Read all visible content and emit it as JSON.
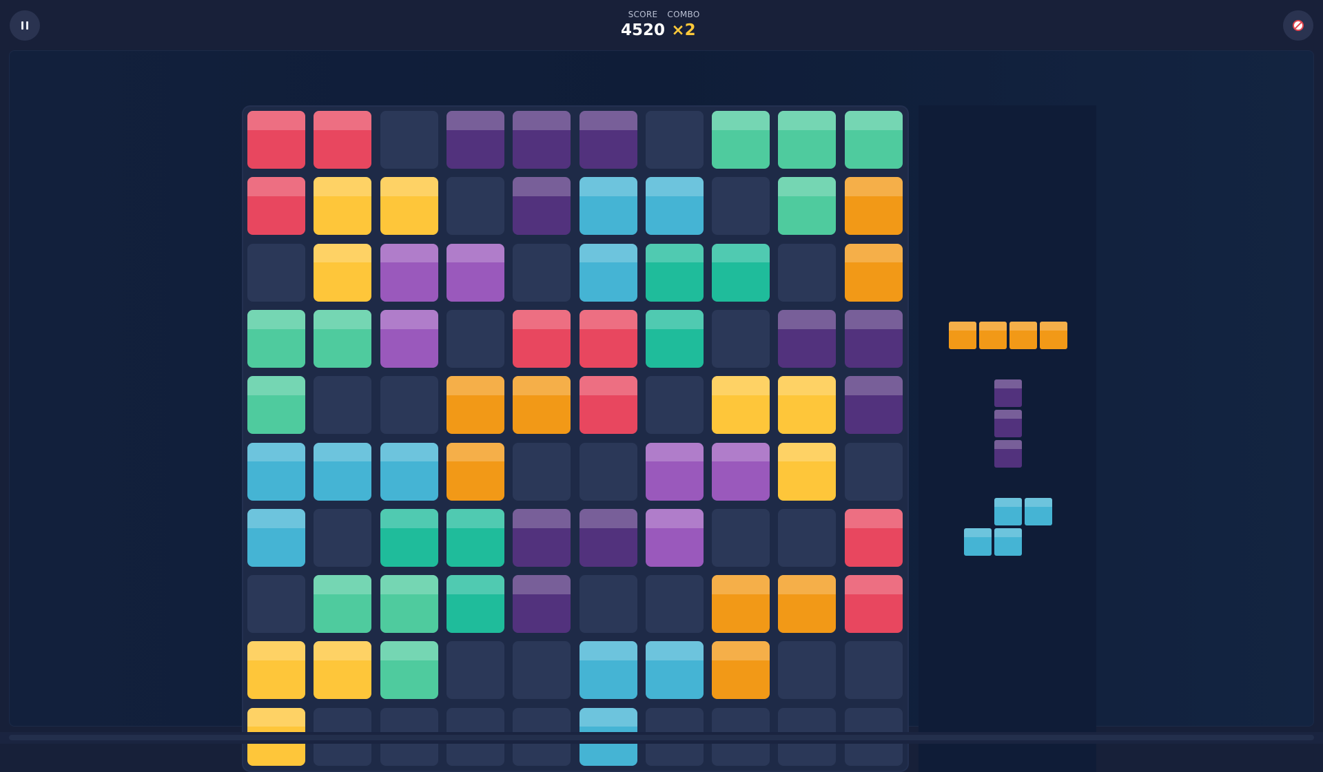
{
  "hud": {
    "score_label": "SCORE",
    "score_value": "4520",
    "combo_label": "COMBO",
    "combo_value": "×2"
  },
  "icons": {
    "pause": "pause-icon",
    "mute": "mute-icon"
  },
  "colors": {
    "R": "#e8475f",
    "Y": "#fec63a",
    "P": "#52327d",
    "V": "#9a59bc",
    "G": "#4fcb9e",
    "T": "#1fbc9b",
    "B": "#45b4d4",
    "O": "#f29917",
    "empty": "#2b3858"
  },
  "board": {
    "rows": [
      [
        "R",
        "R",
        ".",
        "P",
        "P",
        "P",
        ".",
        "G",
        "G",
        "G"
      ],
      [
        "R",
        "Y",
        "Y",
        ".",
        "P",
        "B",
        "B",
        ".",
        "G",
        "O"
      ],
      [
        ".",
        "Y",
        "V",
        "V",
        ".",
        "B",
        "T",
        "T",
        ".",
        "O"
      ],
      [
        "G",
        "G",
        "V",
        ".",
        "R",
        "R",
        "T",
        ".",
        "P",
        "P"
      ],
      [
        "G",
        ".",
        ".",
        "O",
        "O",
        "R",
        ".",
        "Y",
        "Y",
        "P"
      ],
      [
        "B",
        "B",
        "B",
        "O",
        ".",
        ".",
        "V",
        "V",
        "Y",
        "."
      ],
      [
        "B",
        ".",
        "T",
        "T",
        "P",
        "P",
        "V",
        ".",
        ".",
        "R"
      ],
      [
        ".",
        "G",
        "G",
        "T",
        "P",
        ".",
        ".",
        "O",
        "O",
        "R"
      ],
      [
        "Y",
        "Y",
        "G",
        ".",
        ".",
        "B",
        "B",
        "O",
        ".",
        "."
      ],
      [
        "Y",
        ".",
        ".",
        ".",
        ".",
        "B",
        ".",
        ".",
        ".",
        "."
      ]
    ]
  },
  "tray": {
    "pieces": [
      {
        "name": "piece-orange-line",
        "color": "O",
        "cells": [
          [
            0,
            0
          ],
          [
            0,
            1
          ],
          [
            0,
            2
          ],
          [
            0,
            3
          ]
        ]
      },
      {
        "name": "piece-purple-column",
        "color": "P",
        "cells": [
          [
            0,
            0
          ],
          [
            1,
            0
          ],
          [
            2,
            0
          ]
        ]
      },
      {
        "name": "piece-blue-s",
        "color": "B",
        "cells": [
          [
            0,
            1
          ],
          [
            0,
            2
          ],
          [
            1,
            0
          ],
          [
            1,
            1
          ]
        ]
      }
    ]
  }
}
